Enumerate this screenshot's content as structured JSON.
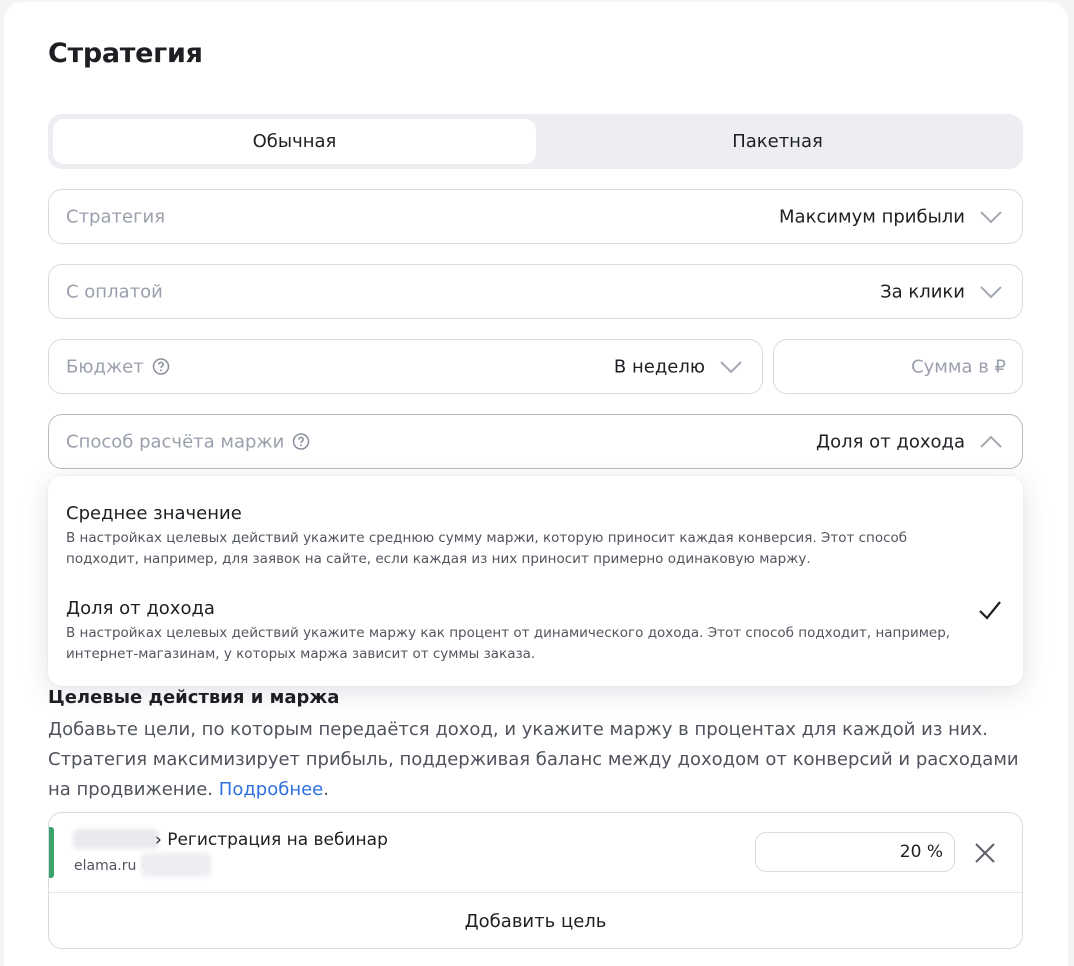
{
  "title": "Стратегия",
  "tabs": [
    {
      "label": "Обычная",
      "active": true
    },
    {
      "label": "Пакетная",
      "active": false
    }
  ],
  "fields": {
    "strategy": {
      "label": "Стратегия",
      "value": "Максимум прибыли"
    },
    "payment": {
      "label": "С оплатой",
      "value": "За клики"
    },
    "budget": {
      "label": "Бюджет",
      "value": "В неделю"
    },
    "budget_amount": {
      "placeholder": "Сумма в ₽"
    },
    "margin_method": {
      "label": "Способ расчёта маржи",
      "value": "Доля от дохода"
    }
  },
  "dropdown": {
    "options": [
      {
        "title": "Среднее значение",
        "description": "В настройках целевых действий укажите среднюю сумму маржи, которую приносит каждая конверсия. Этот способ подходит, например, для заявок на сайте, если каждая из них приносит примерно одинаковую маржу.",
        "selected": false
      },
      {
        "title": "Доля от дохода",
        "description": "В настройках целевых действий укажите маржу как процент от динамического дохода. Этот способ подходит, например, интернет-магазинам, у которых маржа зависит от суммы заказа.",
        "selected": true
      }
    ]
  },
  "section": {
    "title": "Целевые действия и маржа",
    "text": "Добавьте цели, по которым передаётся доход, и укажите маржу в процентах для каждой из них. Стратегия максимизирует прибыль, поддерживая баланс между доходом от конверсий и расходами на продвижение.",
    "link": "Подробнее",
    "after_link": "."
  },
  "goals": [
    {
      "name": "› Регистрация на вебинар",
      "site": "elama.ru •",
      "margin": "20 %"
    }
  ],
  "add_goal_label": "Добавить цель",
  "colors": {
    "accent_link": "#2f6fe0",
    "goal_accent": "#3aa36b"
  },
  "icons": [
    "chevron-down-icon",
    "chevron-up-icon",
    "help-icon",
    "check-icon",
    "close-icon"
  ]
}
